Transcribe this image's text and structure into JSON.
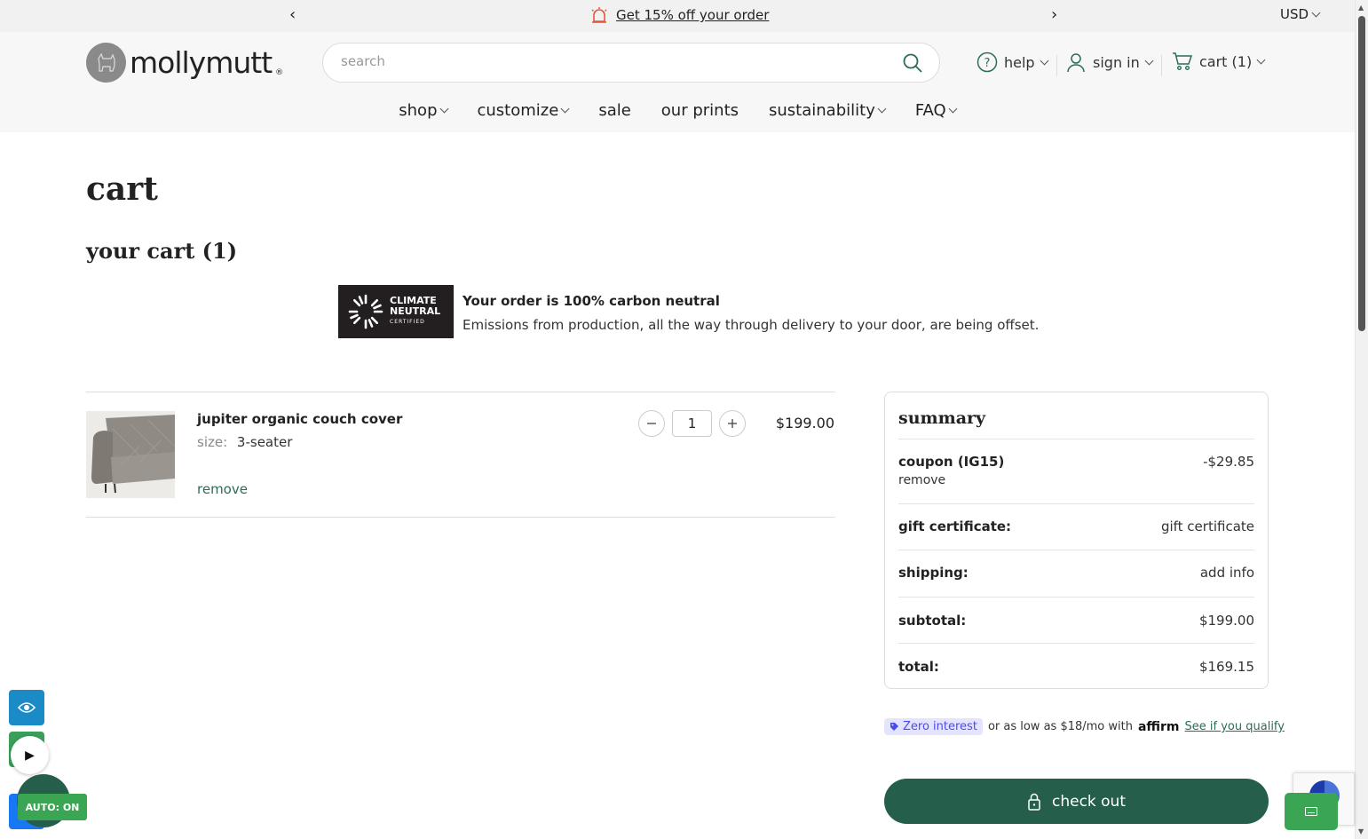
{
  "promo": {
    "message": "Get 15% off your order",
    "currency": "USD"
  },
  "header": {
    "logo_text": "mollymutt",
    "logo_mark": "®",
    "search_placeholder": "search",
    "help_label": "help",
    "signin_label": "sign in",
    "cart_label": "cart (1)"
  },
  "nav": {
    "items": [
      "shop",
      "customize",
      "sale",
      "our prints",
      "sustainability",
      "FAQ"
    ]
  },
  "page": {
    "title": "cart",
    "cart_heading": "your cart (1)"
  },
  "climate": {
    "badge_line1": "CLIMATE",
    "badge_line2": "NEUTRAL",
    "badge_line3": "CERTIFIED",
    "title": "Your order is 100% carbon neutral",
    "description": "Emissions from production, all the way through delivery to your door, are being offset."
  },
  "line_item": {
    "name": "jupiter organic couch cover",
    "size_label": "size:",
    "size_value": "3-seater",
    "remove_label": "remove",
    "quantity": "1",
    "price": "$199.00"
  },
  "summary": {
    "title": "summary",
    "coupon_label": "coupon (IG15)",
    "coupon_value": "-$29.85",
    "coupon_remove": "remove",
    "gift_label": "gift certificate:",
    "gift_value": "gift certificate",
    "shipping_label": "shipping:",
    "shipping_value": "add info",
    "subtotal_label": "subtotal:",
    "subtotal_value": "$199.00",
    "total_label": "total:",
    "total_value": "$169.15"
  },
  "affirm": {
    "pill": "Zero interest",
    "text": "or as low as $18/mo with",
    "brand": "affirm",
    "link": "See if you qualify"
  },
  "checkout": {
    "label": "check out"
  },
  "widgets": {
    "auto_label": "AUTO: ON"
  },
  "colors": {
    "brand_green": "#265e4c",
    "link_green": "#2b6d55",
    "promo_bg": "#f1f1f1",
    "header_bg": "#f7f7f7"
  }
}
